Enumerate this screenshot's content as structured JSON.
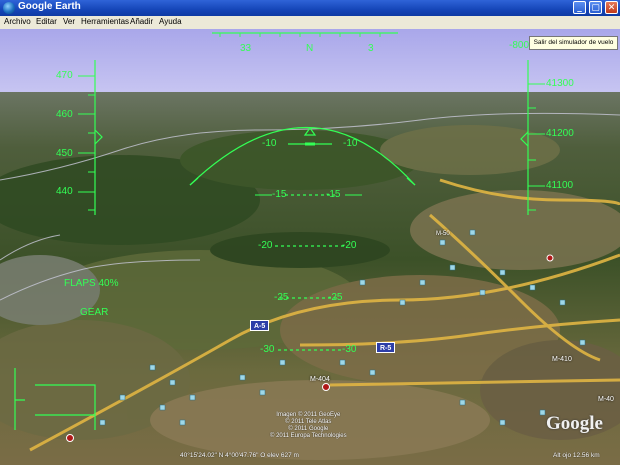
{
  "app": {
    "title": "Google Earth",
    "window_buttons": {
      "minimize": "_",
      "maximize": "▢",
      "close": "✕"
    }
  },
  "menu": {
    "items": [
      "Archivo",
      "Editar",
      "Ver",
      "Herramientas",
      "Añadir",
      "Ayuda"
    ]
  },
  "tooltip": {
    "text": "Salir del simulador de vuelo"
  },
  "hud": {
    "heading": {
      "left": "33",
      "center": "N",
      "right": "3"
    },
    "top_right_value": "-800",
    "speed_ticks": [
      "470",
      "460",
      "450",
      "440"
    ],
    "altitude_ticks": [
      "41300",
      "41200",
      "41100"
    ],
    "pitch_ladder": [
      {
        "left": "-10",
        "right": "-10"
      },
      {
        "left": "-15",
        "right": "-15"
      },
      {
        "left": "-20",
        "right": "-20"
      },
      {
        "left": "-25",
        "right": "-25"
      },
      {
        "left": "-30",
        "right": "-30"
      }
    ],
    "flaps": "FLAPS 40%",
    "gear": "GEAR",
    "colors": {
      "hud": "#33ff55",
      "sky": "#b4b2ee"
    }
  },
  "map": {
    "road_labels": {
      "a5": "A-5",
      "r5": "R-5",
      "m404": "M-404",
      "m410": "M-410",
      "m40": "M-40",
      "m50": "M-50"
    }
  },
  "attribution": {
    "line1": "Imagen © 2011 GeoEye",
    "line2": "© 2011 Tele Atlas",
    "line3": "© 2011 Google",
    "line4": "© 2011 Europa Technologies"
  },
  "status": {
    "coordinates": "40°15'24.02\" N 4°00'47.76\" O  elev  627 m",
    "altitude": "Alt ojo  12.56 km"
  },
  "logo": {
    "text": "Google"
  }
}
